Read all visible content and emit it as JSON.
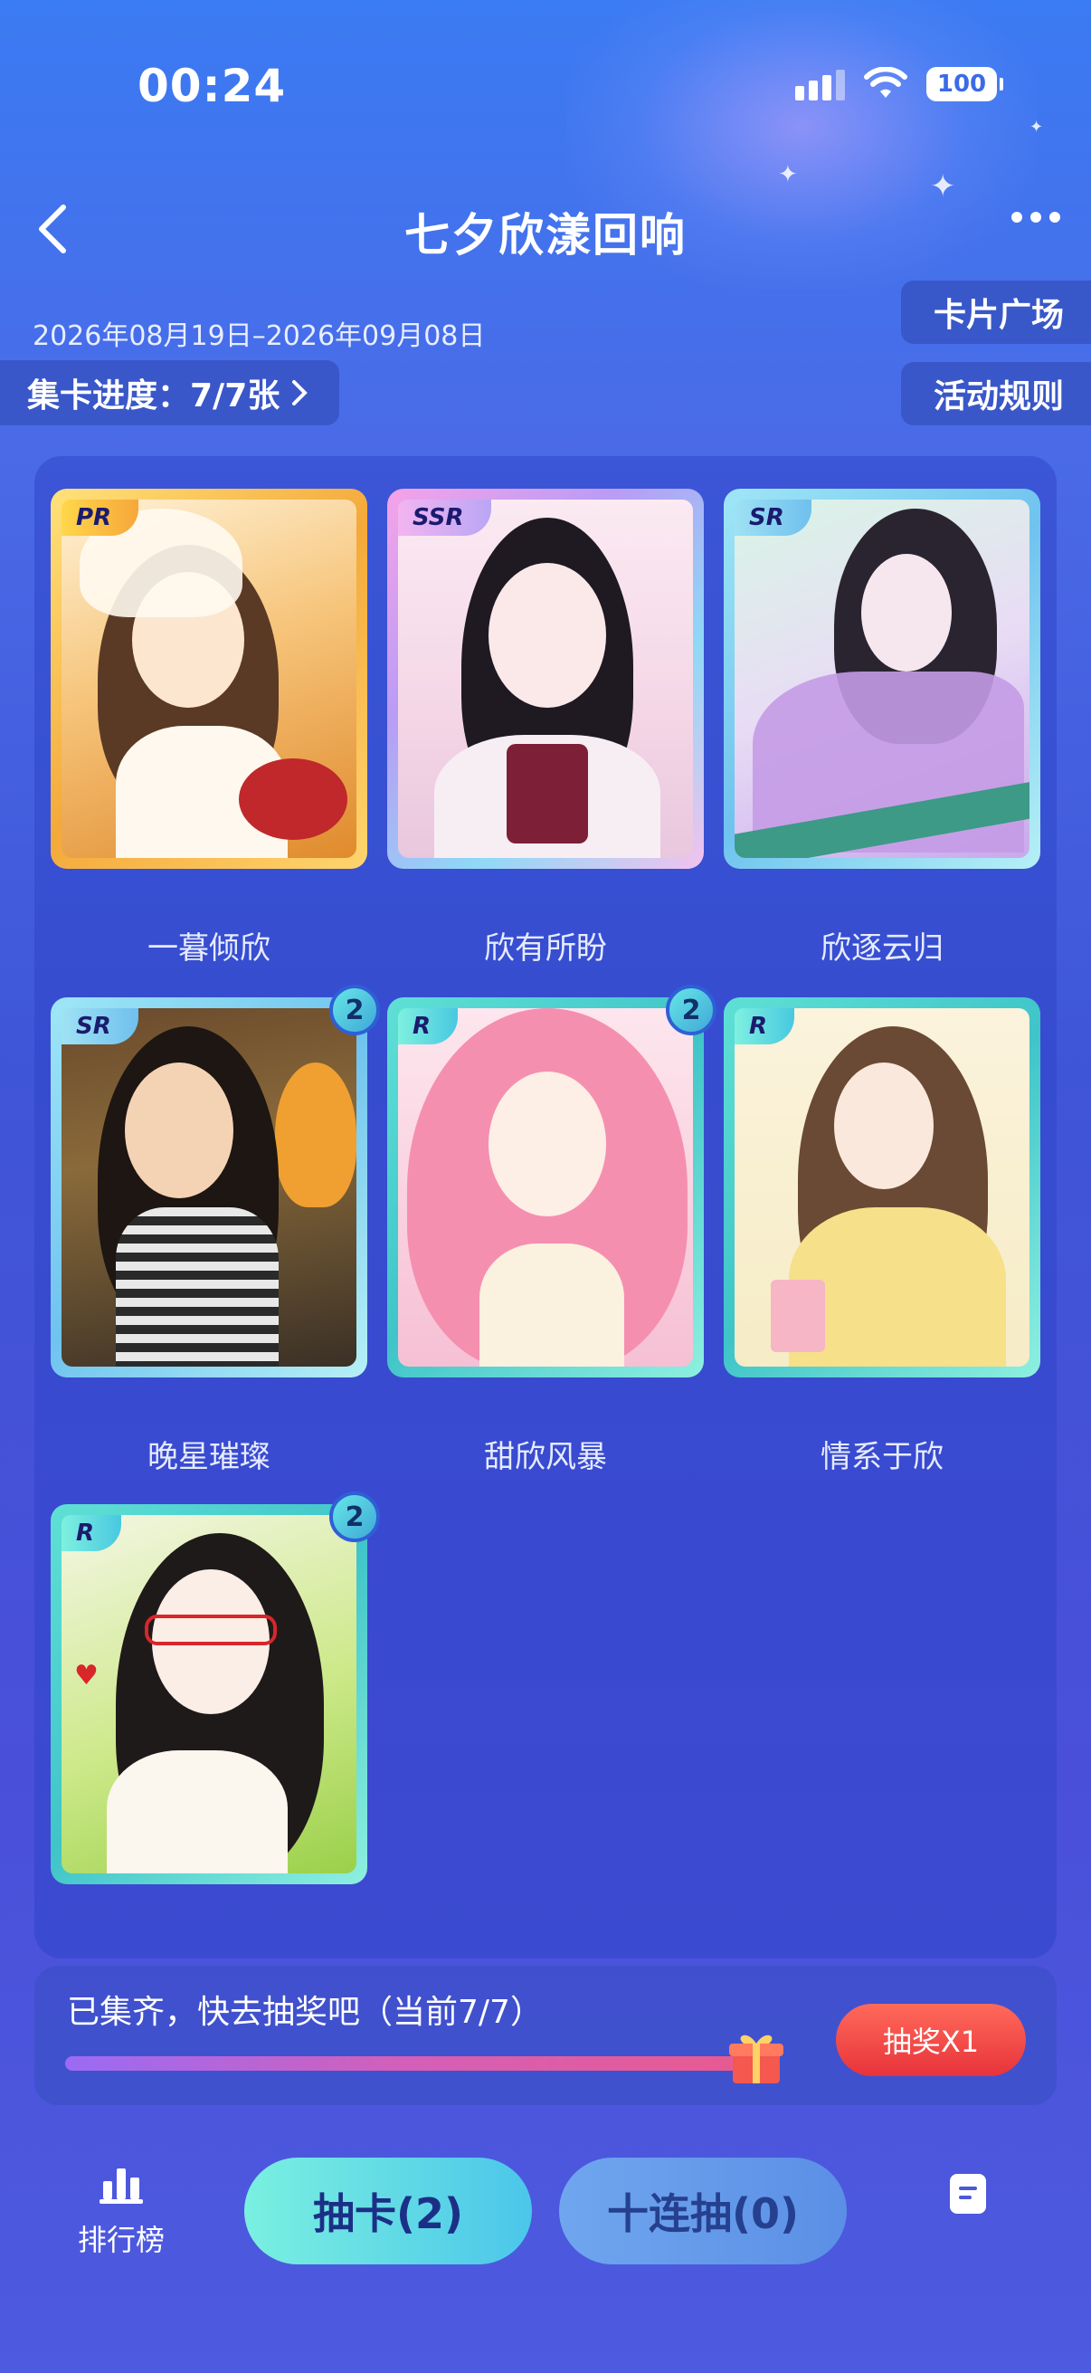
{
  "status_bar": {
    "time": "00:24",
    "battery": "100"
  },
  "header": {
    "title": "七夕欣漾回响"
  },
  "event": {
    "date_range": "2026年08月19日–2026年09月08日",
    "progress_label": "集卡进度：7/7张",
    "card_plaza_button": "卡片广场",
    "rules_button": "活动规则"
  },
  "cards": [
    {
      "name": "一暮倾欣",
      "rarity": "PR",
      "count": ""
    },
    {
      "name": "欣有所盼",
      "rarity": "SSR",
      "count": ""
    },
    {
      "name": "欣逐云归",
      "rarity": "SR",
      "count": ""
    },
    {
      "name": "晚星璀璨",
      "rarity": "SR",
      "count": "2"
    },
    {
      "name": "甜欣风暴",
      "rarity": "R",
      "count": "2"
    },
    {
      "name": "情系于欣",
      "rarity": "R",
      "count": ""
    },
    {
      "name": "",
      "rarity": "R",
      "count": "2"
    }
  ],
  "lottery": {
    "status_text": "已集齐，快去抽奖吧（当前7/7）",
    "progress": 1.0,
    "button_label": "抽奖X1"
  },
  "bottom_nav": {
    "rank_label": "排行榜",
    "draw_one_label": "抽卡(2)",
    "draw_ten_label": "十连抽(0)"
  },
  "colors": {
    "accent": "#3f55d8",
    "lottery_button": "#e8333b",
    "draw_button": "#5fdbe6"
  }
}
